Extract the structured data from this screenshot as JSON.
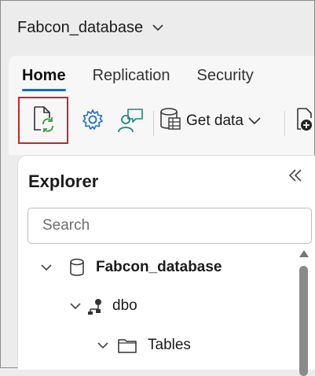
{
  "window": {
    "title": "Fabcon_database",
    "title_chevron": "chevron-down-icon"
  },
  "ribbon": {
    "tabs": [
      {
        "label": "Home",
        "active": true
      },
      {
        "label": "Replication",
        "active": false
      },
      {
        "label": "Security",
        "active": false
      }
    ],
    "toolbar": {
      "refresh_icon": "refresh-document-icon",
      "settings_icon": "gear-icon",
      "share_icon": "person-feedback-icon",
      "get_data_label": "Get data",
      "new_icon": "new-document-icon"
    },
    "highlight_color": "#c0272d",
    "accent_color": "#0f6cbd"
  },
  "explorer": {
    "title": "Explorer",
    "search_placeholder": "Search",
    "tree": [
      {
        "label": "Fabcon_database",
        "icon": "database-icon",
        "level": 0
      },
      {
        "label": "dbo",
        "icon": "schema-icon",
        "level": 1
      },
      {
        "label": "Tables",
        "icon": "folder-icon",
        "level": 2
      }
    ]
  }
}
